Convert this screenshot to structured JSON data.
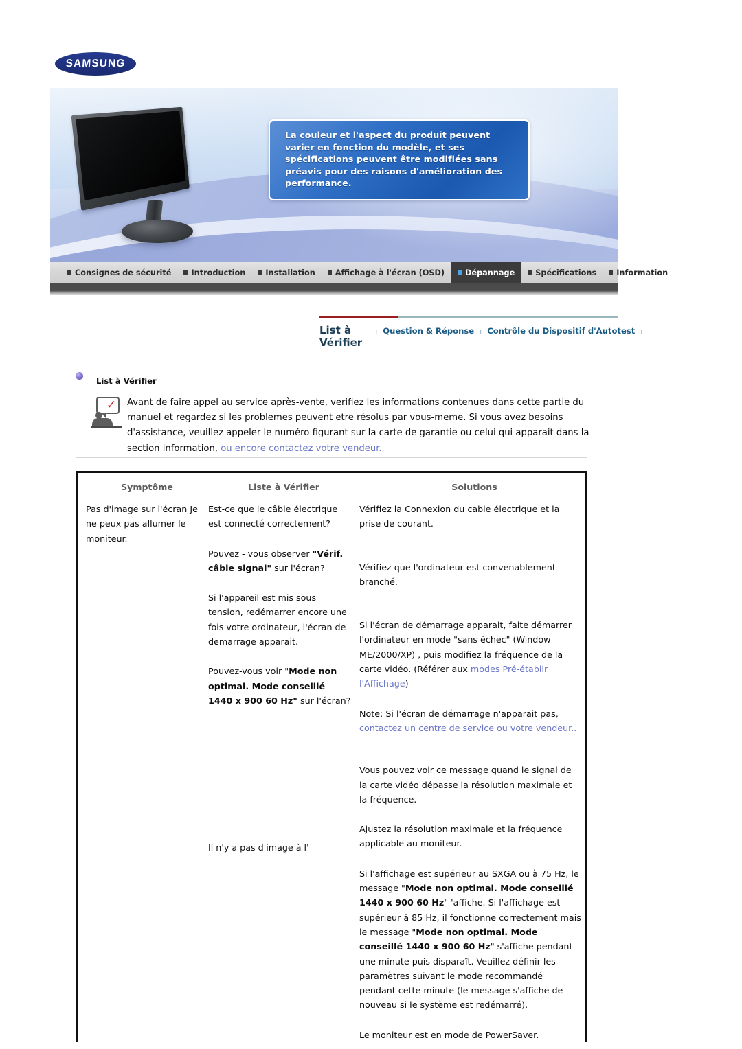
{
  "brand": {
    "logo_text": "SAMSUNG"
  },
  "banner": {
    "notice": "La couleur et l'aspect du produit peuvent varier en fonction du modèle, et ses spécifications peuvent être modifiées sans préavis pour des raisons d'amélioration des performance."
  },
  "mainnav": {
    "items": [
      {
        "label": "Consignes de sécurité",
        "active": false
      },
      {
        "label": "Introduction",
        "active": false
      },
      {
        "label": "Installation",
        "active": false
      },
      {
        "label": "Affichage à l'écran (OSD)",
        "active": false
      },
      {
        "label": "Dépannage",
        "active": true
      },
      {
        "label": "Spécifications",
        "active": false
      },
      {
        "label": "Information",
        "active": false
      }
    ]
  },
  "subnav": {
    "items": [
      "List à Vérifier",
      "Question & Réponse",
      "Contrôle du Dispositif d'Autotest"
    ],
    "separator": "ı"
  },
  "section": {
    "title": "List à Vérifier",
    "intro_part1": "Avant de faire appel au service après-vente, verifiez les informations contenues dans cette partie du manuel et regardez si les problemes peuvent etre résolus par vous-meme. Si vous avez besoins d'assistance, veuillez appeler le numéro figurant sur la carte de garantie ou celui qui apparait dans la section information, ",
    "intro_link": "ou encore contactez votre vendeur."
  },
  "table": {
    "headers": [
      "Symptôme",
      "Liste à Vérifier",
      "Solutions"
    ],
    "rows": [
      {
        "symptom": "Pas d'image sur l'écran Je ne peux pas allumer le moniteur.",
        "checks": [
          {
            "text_before": "Est-ce que le câble électrique est connecté correctement?",
            "bold": "",
            "text_after": ""
          },
          {
            "text_before": "Pouvez - vous observer ",
            "bold": "\"Vérif. câble signal\"",
            "text_after": " sur l'écran?"
          },
          {
            "text_before": "Si l'appareil est mis sous tension, redémarrer encore une fois votre ordinateur, l'écran de demarrage apparait.",
            "bold": "",
            "text_after": ""
          },
          {
            "text_before": "Pouvez-vous voir \"",
            "bold": "Mode non optimal. Mode conseillé 1440 x 900 60 Hz\"",
            "text_after": " sur l'écran?"
          },
          {
            "text_before": "Il n'y a pas d'image à l'",
            "bold": "",
            "text_after": ""
          }
        ],
        "solutions": [
          {
            "p": "Vérifiez la Connexion du cable électrique et la prise de courant."
          },
          {
            "p": "Vérifiez que l'ordinateur est convenablement branché."
          },
          {
            "p": "Si l'écran de démarrage apparait, faite démarrer l'ordinateur en mode \"sans échec\" (Window ME/2000/XP) , puis modifiez la fréquence de la carte vidéo. (Référer aux ",
            "link": "modes Pré-établir l'Affichage",
            "p_after": ")"
          },
          {
            "p": "Note: Si l'écran de démarrage n'apparait pas, ",
            "link": "contactez un centre de service ou votre vendeur..",
            "p_after": ""
          },
          {
            "p": "Vous pouvez voir ce message quand le signal de la carte vidéo dépasse la résolution maximale et la fréquence."
          },
          {
            "p": "Ajustez la résolution maximale et la fréquence applicable au moniteur."
          },
          {
            "p": "Si l'affichage est supérieur au SXGA ou à 75 Hz, le message \"Mode non optimal. Mode conseillé 1440 x 900 60 Hz\" 'affiche. Si l'affichage est supérieur à 85 Hz, il fonctionne correctement mais le message \"Mode non optimal. Mode conseillé 1440 x 900 60 Hz\" s'affiche pendant une minute puis disparaît. Veuillez définir les paramètres suivant le mode recommandé pendant cette minute (le message s'affiche de nouveau si le système est redémarré)."
          },
          {
            "p": "Le moniteur est en mode de PowerSaver."
          }
        ]
      }
    ],
    "cells": {
      "r1c1": "Pas d'image sur l'écran Je ne peux pas allumer le moniteur.",
      "r1c2_a": "Est-ce que le câble électrique est connecté correctement?",
      "r1c3_a": "Vérifiez la Connexion du cable électrique et la prise de courant.",
      "r2c2_pre": "Pouvez - vous observer ",
      "r2c2_bold": "\"Vérif. câble signal\"",
      "r2c2_post": " sur l'écran?",
      "r2c3": "Vérifiez que l'ordinateur est convenablement branché.",
      "r3c2": "Si l'appareil est mis sous tension, redémarrer encore une fois votre ordinateur, l'écran de demarrage apparait.",
      "r3c3_pre": "Si l'écran de démarrage apparait, faite démarrer l'ordinateur en mode \"sans échec\" (Window ME/2000/XP) , puis modifiez la fréquence de la carte vidéo. (Référer aux ",
      "r3c3_link": "modes Pré-établir l'Affichage",
      "r3c3_post": ")",
      "r4c3_pre": "Note: Si l'écran de démarrage n'apparait pas, ",
      "r4c3_link": "contactez un centre de service ou votre vendeur..",
      "r5c2_pre": "Pouvez-vous voir \"",
      "r5c2_bold": "Mode non optimal. Mode conseillé 1440 x 900 60 Hz\"",
      "r5c2_post": " sur l'écran?",
      "r5c3": "Vous pouvez voir ce message quand le signal de la carte vidéo dépasse la résolution maximale et la fréquence.",
      "r6c3": "Ajustez la résolution maximale et la fréquence applicable au moniteur.",
      "r7c3_a": "Si l'affichage est supérieur au SXGA ou à 75 Hz, le message \"",
      "r7c3_b1": "Mode non optimal. Mode conseillé 1440 x 900 60 Hz",
      "r7c3_b": "\" 'affiche. Si l'affichage est supérieur à 85 Hz, il fonctionne correctement mais le message \"",
      "r7c3_b2": "Mode non optimal. Mode conseillé 1440 x 900 60 Hz",
      "r7c3_c": "\" s'affiche pendant une minute puis disparaît. Veuillez définir les paramètres suivant le mode recommandé pendant cette minute (le message s'affiche de nouveau si le système est redémarré).",
      "r8c2": "Il n'y a pas d'image à l'",
      "r8c3": "Le moniteur est en mode de PowerSaver."
    }
  },
  "colors": {
    "brand_blue": "#1f2f7c",
    "link": "#6a76c8",
    "subnav_blue": "#1a5b84",
    "accent_red": "#9c1f1f",
    "active_tab_bg": "#3b3b3b",
    "active_tab_marker": "#4aa6e8"
  }
}
